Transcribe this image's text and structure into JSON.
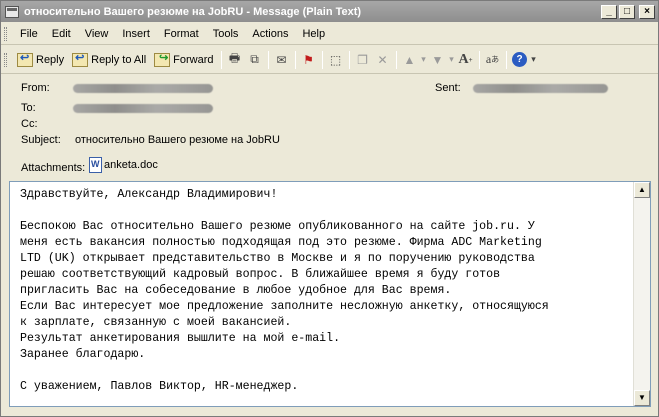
{
  "window": {
    "title": "относительно Вашего резюме на JobRU - Message (Plain Text)",
    "controls": {
      "minimize": "_",
      "maximize": "□",
      "close": "×"
    }
  },
  "menu": [
    "File",
    "Edit",
    "View",
    "Insert",
    "Format",
    "Tools",
    "Actions",
    "Help"
  ],
  "toolbar": {
    "reply": "Reply",
    "reply_all": "Reply to All",
    "forward": "Forward",
    "icons": [
      "print-icon",
      "copy-icon",
      "move-to-folder-icon",
      "junk-mail-icon",
      "flag-icon",
      "categorize-icon",
      "copy-doc-icon",
      "delete-icon",
      "previous-icon",
      "next-icon",
      "font-size-icon",
      "encoding-icon",
      "help-icon"
    ]
  },
  "header": {
    "from_label": "From:",
    "to_label": "To:",
    "cc_label": "Cc:",
    "subject_label": "Subject:",
    "subject_value": "относительно Вашего резюме на JobRU",
    "sent_label": "Sent:",
    "attachments_label": "Attachments:",
    "attachment_name": "anketa.doc"
  },
  "body": {
    "text": "Здравствуйте, Александр Владимирович!\n\nБеспокою Вас относительно Вашего резюме опубликованного на сайте job.ru. У\nменя есть вакансия полностью подходящая под это резюме. Фирма ADC Marketing\nLTD (UK) открывает представительство в Москве и я по поручению руководства\nрешаю соответствующий кадровый вопрос. В ближайшее время я буду готов\nпригласить Вас на собеседование в любое удобное для Вас время.\nЕсли Вас интересует мое предложение заполните несложную анкетку, относящуюся\nк зарплате, связанную с моей вакансией.\nРезультат анкетирования вышлите на мой e-mail.\nЗаранее благодарю.\n\nС уважением, Павлов Виктор, HR-менеджер."
  },
  "scrollbar": {
    "up": "▲",
    "down": "▼"
  }
}
